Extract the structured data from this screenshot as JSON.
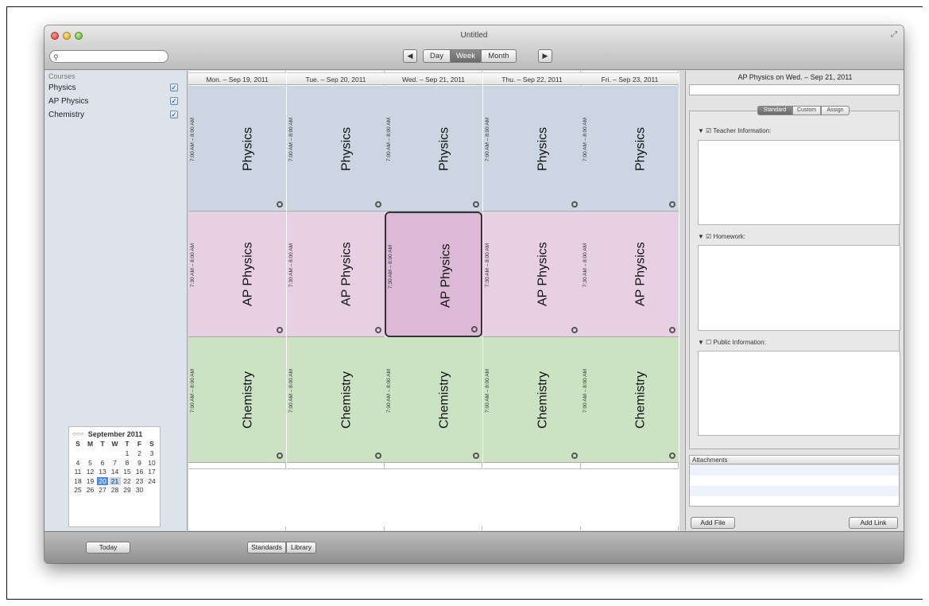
{
  "window": {
    "title": "Untitled"
  },
  "search": {
    "placeholder": ""
  },
  "nav": {
    "prev": "◀",
    "next": "▶",
    "day": "Day",
    "week": "Week",
    "month": "Month"
  },
  "sidebar": {
    "heading": "Courses",
    "courses": [
      {
        "label": "Physics",
        "checked": true
      },
      {
        "label": "AP Physics",
        "checked": true
      },
      {
        "label": "Chemistry",
        "checked": true
      }
    ]
  },
  "mini_calendar": {
    "title": "September 2011",
    "weekdays": [
      "S",
      "M",
      "T",
      "W",
      "T",
      "F",
      "S"
    ],
    "weeks": [
      [
        "",
        "",
        "",
        "",
        "1",
        "2",
        "3"
      ],
      [
        "4",
        "5",
        "6",
        "7",
        "8",
        "9",
        "10"
      ],
      [
        "11",
        "12",
        "13",
        "14",
        "15",
        "16",
        "17"
      ],
      [
        "18",
        "19",
        "20",
        "21",
        "22",
        "23",
        "24"
      ],
      [
        "25",
        "26",
        "27",
        "28",
        "29",
        "30",
        ""
      ]
    ],
    "selected": "20",
    "highlighted": "21"
  },
  "week": {
    "days": [
      "Mon. – Sep 19, 2011",
      "Tue. – Sep 20, 2011",
      "Wed. – Sep 21, 2011",
      "Thu. – Sep 22, 2011",
      "Fri. – Sep 23, 2011"
    ],
    "blocks": [
      {
        "course": "Physics",
        "time": "7:00 AM – 8:00 AM",
        "color": "#cbd6e2"
      },
      {
        "course": "AP Physics",
        "time": "7:30 AM – 8:00 AM",
        "color": "#e7cfe4"
      },
      {
        "course": "Chemistry",
        "time": "7:00 AM – 8:00 AM",
        "color": "#cbe3c3"
      }
    ],
    "selected_day_index": 2,
    "selected_block": "AP Physics"
  },
  "detail": {
    "title": "AP Physics on Wed. – Sep 21, 2011",
    "tabs": [
      "Standard",
      "Custom",
      "Assign"
    ],
    "active_tab": "Standard",
    "sections": [
      {
        "label": "Teacher Information:",
        "checked": true
      },
      {
        "label": "Homework:",
        "checked": true
      },
      {
        "label": "Public Information:",
        "checked": false
      }
    ],
    "attachments_label": "Attachments",
    "add_file": "Add File",
    "add_link": "Add Link"
  },
  "footer": {
    "today": "Today",
    "standards": "Standards",
    "library": "Library"
  }
}
